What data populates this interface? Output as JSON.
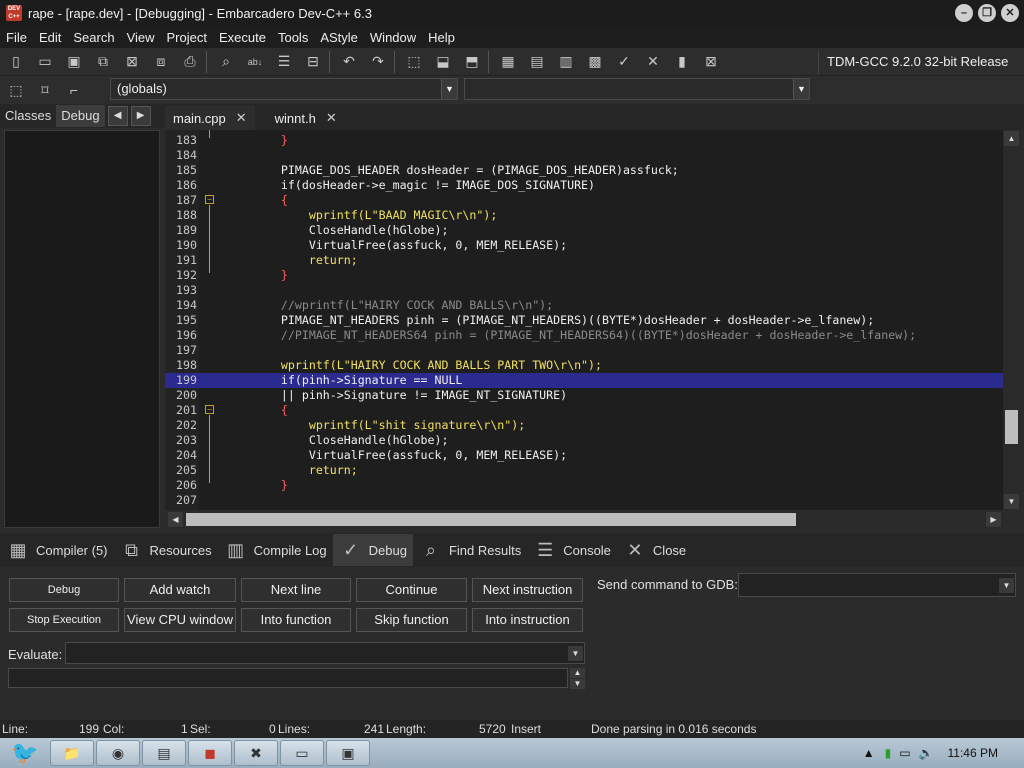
{
  "window": {
    "title": "rape - [rape.dev] - [Debugging] - Embarcadero Dev-C++ 6.3"
  },
  "menu": [
    "File",
    "Edit",
    "Search",
    "View",
    "Project",
    "Execute",
    "Tools",
    "AStyle",
    "Window",
    "Help"
  ],
  "toolbar": {
    "compiler": "TDM-GCC 9.2.0 32-bit Release"
  },
  "scope_combo": {
    "value": "(globals)"
  },
  "left_tabs": [
    "Classes",
    "Debug"
  ],
  "editor_tabs": [
    {
      "label": "main.cpp"
    },
    {
      "label": "winnt.h"
    }
  ],
  "code": [
    {
      "n": "183",
      "t": "    }"
    },
    {
      "n": "184",
      "t": ""
    },
    {
      "n": "185",
      "t": "    PIMAGE_DOS_HEADER dosHeader = (PIMAGE_DOS_HEADER)assfuck;"
    },
    {
      "n": "186",
      "t": "    if(dosHeader->e_magic != IMAGE_DOS_SIGNATURE)"
    },
    {
      "n": "187",
      "t": "    {"
    },
    {
      "n": "188",
      "t": "        wprintf(L\"BAAD MAGIC\\r\\n\");"
    },
    {
      "n": "189",
      "t": "        CloseHandle(hGlobe);"
    },
    {
      "n": "190",
      "t": "        VirtualFree(assfuck, 0, MEM_RELEASE);"
    },
    {
      "n": "191",
      "t": "        return;"
    },
    {
      "n": "192",
      "t": "    }"
    },
    {
      "n": "193",
      "t": ""
    },
    {
      "n": "194",
      "t": "    //wprintf(L\"HAIRY COCK AND BALLS\\r\\n\");"
    },
    {
      "n": "195",
      "t": "    PIMAGE_NT_HEADERS pinh = (PIMAGE_NT_HEADERS)((BYTE*)dosHeader + dosHeader->e_lfanew);"
    },
    {
      "n": "196",
      "t": "    //PIMAGE_NT_HEADERS64 pinh = (PIMAGE_NT_HEADERS64)((BYTE*)dosHeader + dosHeader->e_lfanew);"
    },
    {
      "n": "197",
      "t": ""
    },
    {
      "n": "198",
      "t": "    wprintf(L\"HAIRY COCK AND BALLS PART TWO\\r\\n\");"
    },
    {
      "n": "199",
      "t": "    if(pinh->Signature == NULL"
    },
    {
      "n": "200",
      "t": "    || pinh->Signature != IMAGE_NT_SIGNATURE)"
    },
    {
      "n": "201",
      "t": "    {"
    },
    {
      "n": "202",
      "t": "        wprintf(L\"shit signature\\r\\n\");"
    },
    {
      "n": "203",
      "t": "        CloseHandle(hGlobe);"
    },
    {
      "n": "204",
      "t": "        VirtualFree(assfuck, 0, MEM_RELEASE);"
    },
    {
      "n": "205",
      "t": "        return;"
    },
    {
      "n": "206",
      "t": "    }"
    },
    {
      "n": "207",
      "t": ""
    }
  ],
  "bottom_tabs": [
    "Compiler (5)",
    "Resources",
    "Compile Log",
    "Debug",
    "Find Results",
    "Console",
    "Close"
  ],
  "debug": {
    "debug_btn": "Debug",
    "add_watch": "Add watch",
    "next_line": "Next line",
    "continue": "Continue",
    "next_instruction": "Next instruction",
    "stop_execution": "Stop Execution",
    "view_cpu": "View CPU window",
    "into_function": "Into function",
    "skip_function": "Skip function",
    "into_instruction": "Into instruction",
    "send_cmd_label": "Send command to GDB:",
    "evaluate_label": "Evaluate:"
  },
  "status": {
    "line_label": "Line:",
    "line": "199",
    "col_label": "Col:",
    "col": "1",
    "sel_label": "Sel:",
    "sel": "0",
    "lines_label": "Lines:",
    "lines": "241",
    "length_label": "Length:",
    "length": "5720",
    "mode": "Insert",
    "message": "Done parsing in 0.016 seconds"
  },
  "taskbar": {
    "clock": "11:46 PM"
  }
}
